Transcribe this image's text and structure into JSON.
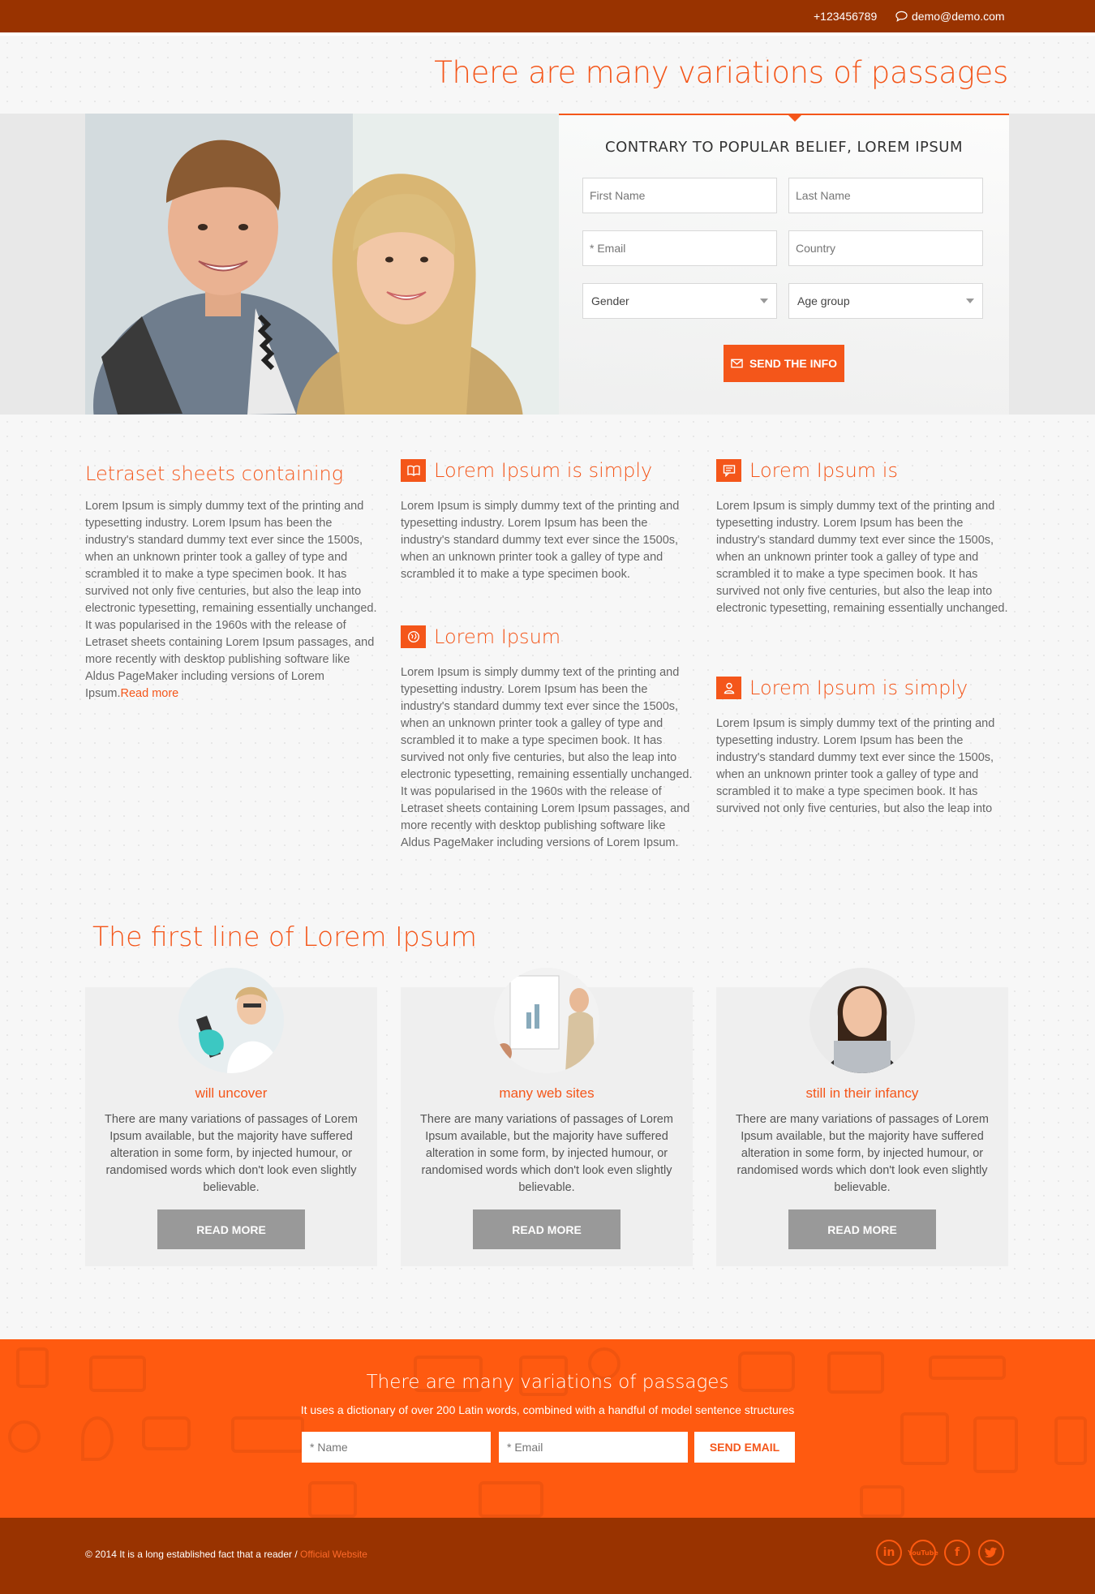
{
  "topbar": {
    "phone": "+123456789",
    "email": "demo@demo.com"
  },
  "hero": {
    "title": "There are many variations of passages",
    "form_title": "CONTRARY TO POPULAR BELIEF, LOREM IPSUM",
    "fields": {
      "first_name": "First Name",
      "last_name": "Last Name",
      "email": "* Email",
      "country": "Country",
      "gender": "Gender",
      "age_group": "Age group"
    },
    "submit": "SEND THE INFO"
  },
  "features": {
    "f1": {
      "title": "Letraset sheets containing",
      "text": "Lorem Ipsum is simply dummy text of the printing and typesetting industry. Lorem Ipsum has been the industry's standard dummy text ever since the 1500s, when an unknown printer took a galley of type and scrambled it to make a type specimen book. It has survived not only five centuries, but also the leap into electronic typesetting, remaining essentially unchanged. It was popularised in the 1960s with the release of Letraset sheets containing Lorem Ipsum passages, and more recently with desktop publishing software like Aldus PageMaker including versions of Lorem Ipsum.",
      "link": "Read more"
    },
    "f2": {
      "title": "Lorem Ipsum is simply",
      "icon": "book-icon",
      "text": "Lorem Ipsum is simply dummy text of the printing and typesetting industry. Lorem Ipsum has been the industry's standard dummy text ever since the 1500s, when an unknown printer took a galley of type and scrambled it to make a type specimen book."
    },
    "f3": {
      "title": "Lorem Ipsum is",
      "icon": "chat-icon",
      "text": "Lorem Ipsum is simply dummy text of the printing and typesetting industry. Lorem Ipsum has been the industry's standard dummy text ever since the 1500s, when an unknown printer took a galley of type and scrambled it to make a type specimen book. It has survived not only five centuries, but also the leap into electronic typesetting, remaining essentially unchanged."
    },
    "f4": {
      "title": "Lorem Ipsum",
      "icon": "globe-icon",
      "text": "Lorem Ipsum is simply dummy text of the printing and typesetting industry. Lorem Ipsum has been the industry's standard dummy text ever since the 1500s, when an unknown printer took a galley of type and scrambled it to make a type specimen book. It has survived not only five centuries, but also the leap into electronic typesetting, remaining essentially unchanged. It was popularised in the 1960s with the release of Letraset sheets containing Lorem Ipsum passages, and more recently with desktop publishing software like Aldus PageMaker including versions of Lorem Ipsum."
    },
    "f5": {
      "title": "Lorem Ipsum is simply",
      "icon": "user-icon",
      "text": "Lorem Ipsum is simply dummy text of the printing and typesetting industry. Lorem Ipsum has been the industry's standard dummy text ever since the 1500s, when an unknown printer took a galley of type and scrambled it to make a type specimen book. It has survived not only five centuries, but also the leap into"
    }
  },
  "section2": {
    "title": "The first line of Lorem Ipsum",
    "cards": [
      {
        "title": "will uncover",
        "text": "There are many variations of passages of Lorem Ipsum available, but the majority have suffered alteration in some form, by injected humour, or randomised words which don't look even slightly believable.",
        "button": "READ MORE"
      },
      {
        "title": "many web sites",
        "text": "There are many variations of passages of Lorem Ipsum available, but the majority have suffered alteration in some form, by injected humour, or randomised words which don't look even slightly believable.",
        "button": "READ MORE"
      },
      {
        "title": "still in their infancy",
        "text": "There are many variations of passages of Lorem Ipsum available, but the majority have suffered alteration in some form, by injected humour, or randomised words which don't look even slightly believable.",
        "button": "READ MORE"
      }
    ]
  },
  "cta": {
    "title": "There are many variations of passages",
    "subtitle": "It uses a dictionary of over 200 Latin words, combined with a handful of model sentence structures",
    "name_placeholder": "* Name",
    "email_placeholder": "* Email",
    "button": "SEND EMAIL"
  },
  "footer": {
    "copyright": "© 2014 It is a long established fact that a reader / ",
    "link": "Official Website",
    "social": [
      "in",
      "YouTube",
      "f",
      "twitter"
    ]
  },
  "colors": {
    "accent": "#f4561a",
    "dark": "#993300",
    "cta": "#ff5a10",
    "button_gray": "#999999"
  }
}
